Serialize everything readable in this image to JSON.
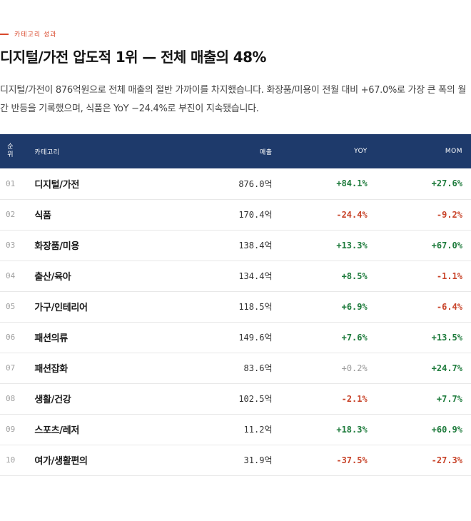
{
  "eyebrow": "카테고리 성과",
  "headline": "디지털/가전 압도적 1위 — 전체 매출의 48%",
  "lede": "디지털/가전이 876억원으로 전체 매출의 절반 가까이를 차지했습니다. 화장품/미용이 전월 대비 +67.0%로 가장 큰 폭의 월간 반등을 기록했으며, 식품은 YoY −24.4%로 부진이 지속됐습니다.",
  "colors": {
    "accent": "#d9482b",
    "header_bg": "#1e3a6b",
    "positive": "#1e7b3c",
    "negative": "#c8442a",
    "neutral": "#999999"
  },
  "table": {
    "headers": {
      "rank_1": "순",
      "rank_2": "위",
      "category": "카테고리",
      "sales": "매출",
      "yoy": "YOY",
      "mom": "MOM"
    },
    "rows": [
      {
        "rank": "01",
        "category": "디지털/가전",
        "sales": "876.0억",
        "yoy": "+84.1%",
        "yoy_tone": "pos",
        "mom": "+27.6%",
        "mom_tone": "pos"
      },
      {
        "rank": "02",
        "category": "식품",
        "sales": "170.4억",
        "yoy": "-24.4%",
        "yoy_tone": "neg",
        "mom": "-9.2%",
        "mom_tone": "neg"
      },
      {
        "rank": "03",
        "category": "화장품/미용",
        "sales": "138.4억",
        "yoy": "+13.3%",
        "yoy_tone": "pos",
        "mom": "+67.0%",
        "mom_tone": "pos"
      },
      {
        "rank": "04",
        "category": "출산/육아",
        "sales": "134.4억",
        "yoy": "+8.5%",
        "yoy_tone": "pos",
        "mom": "-1.1%",
        "mom_tone": "neg"
      },
      {
        "rank": "05",
        "category": "가구/인테리어",
        "sales": "118.5억",
        "yoy": "+6.9%",
        "yoy_tone": "pos",
        "mom": "-6.4%",
        "mom_tone": "neg"
      },
      {
        "rank": "06",
        "category": "패션의류",
        "sales": "149.6억",
        "yoy": "+7.6%",
        "yoy_tone": "pos",
        "mom": "+13.5%",
        "mom_tone": "pos"
      },
      {
        "rank": "07",
        "category": "패션잡화",
        "sales": "83.6억",
        "yoy": "+0.2%",
        "yoy_tone": "neu",
        "mom": "+24.7%",
        "mom_tone": "pos"
      },
      {
        "rank": "08",
        "category": "생활/건강",
        "sales": "102.5억",
        "yoy": "-2.1%",
        "yoy_tone": "neg",
        "mom": "+7.7%",
        "mom_tone": "pos"
      },
      {
        "rank": "09",
        "category": "스포츠/레저",
        "sales": "11.2억",
        "yoy": "+18.3%",
        "yoy_tone": "pos",
        "mom": "+60.9%",
        "mom_tone": "pos"
      },
      {
        "rank": "10",
        "category": "여가/생활편의",
        "sales": "31.9억",
        "yoy": "-37.5%",
        "yoy_tone": "neg",
        "mom": "-27.3%",
        "mom_tone": "neg"
      }
    ]
  }
}
